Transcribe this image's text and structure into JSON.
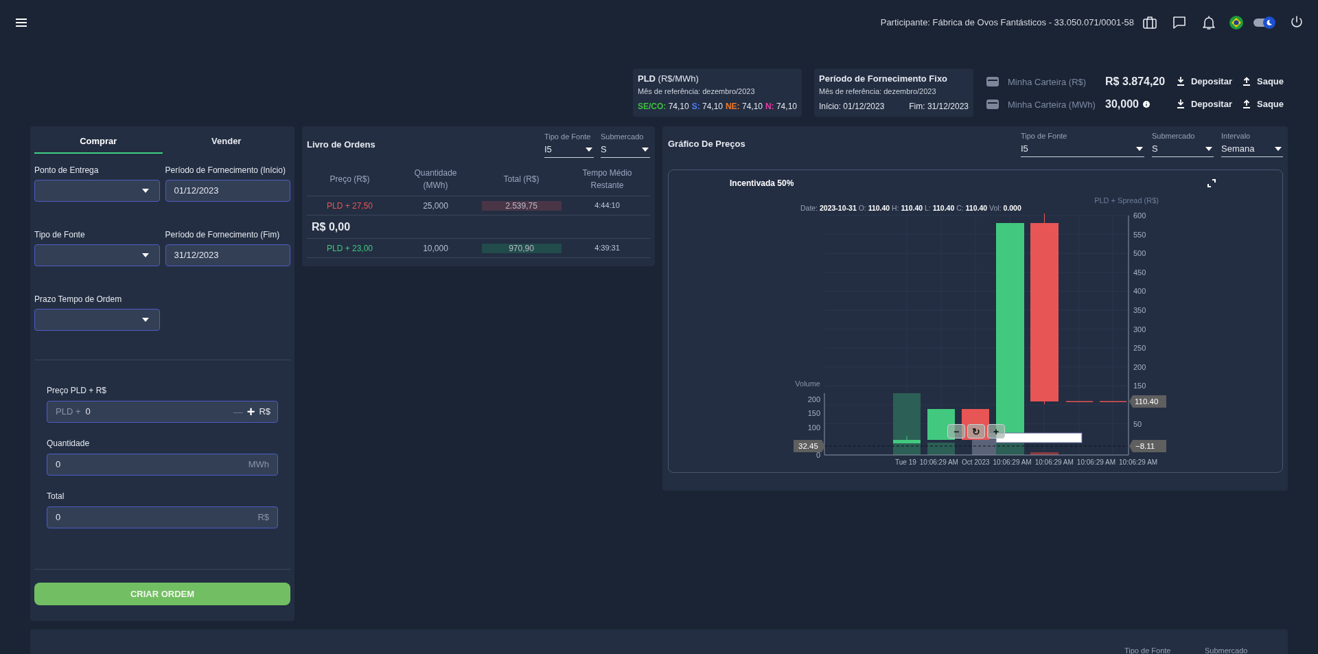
{
  "header": {
    "participant": "Participante: Fábrica de Ovos Fantásticos - 33.050.071/0001-58",
    "theme_toggle": {
      "on": true
    }
  },
  "pld_card": {
    "title": "PLD",
    "unit": "(R$/MWh)",
    "reference": "Mês de referência: dezembro/2023",
    "submarkets": [
      {
        "label": "SE/CO:",
        "value": "74,10",
        "color": "#3fbf3f"
      },
      {
        "label": "S:",
        "value": "74,10",
        "color": "#4f7dff"
      },
      {
        "label": "NE:",
        "value": "74,10",
        "color": "#f07a2a"
      },
      {
        "label": "N:",
        "value": "74,10",
        "color": "#e83aa8"
      }
    ]
  },
  "supply_card": {
    "title": "Período de Fornecimento Fixo",
    "reference": "Mês de referência: dezembro/2023",
    "start": "Início: 01/12/2023",
    "end": "Fim: 31/12/2023"
  },
  "wallets": [
    {
      "label": "Minha Carteira (R$)",
      "balance": "R$ 3.874,20",
      "info": false,
      "deposit": "Depositar",
      "withdraw": "Saque"
    },
    {
      "label": "Minha Carteira (MWh)",
      "balance": "30,000",
      "info": true,
      "deposit": "Depositar",
      "withdraw": "Saque"
    }
  ],
  "order_form": {
    "tabs": [
      {
        "label": "Comprar",
        "selected": true
      },
      {
        "label": "Vender",
        "selected": false
      }
    ],
    "fields": [
      {
        "label": "Ponto de Entrega",
        "kind": "select"
      },
      {
        "label": "Período de Fornecimento (Início)",
        "kind": "date",
        "value": "01/12/2023"
      },
      {
        "label": "Tipo de Fonte",
        "kind": "select"
      },
      {
        "label": "Período de Fornecimento (Fim)",
        "kind": "date",
        "value": "31/12/2023"
      },
      {
        "label": "Prazo Tempo de Ordem",
        "kind": "select"
      }
    ],
    "price": {
      "label": "Preço PLD + R$",
      "prefix": "PLD +",
      "value": "0",
      "decrement": "—",
      "increment": "+",
      "decrement_disabled": true,
      "suffix": "R$"
    },
    "quantity": {
      "label": "Quantidade",
      "value": "0",
      "suffix": "MWh"
    },
    "total": {
      "label": "Total",
      "value": "0",
      "suffix": "R$"
    },
    "submit": "CRIAR ORDEM"
  },
  "order_book": {
    "title": "Livro de Ordens",
    "filters": [
      {
        "label": "Tipo de Fonte",
        "value": "I5"
      },
      {
        "label": "Submercado",
        "value": "S"
      }
    ],
    "columns": [
      "Preço (R$)",
      "Quantidade (MWh)",
      "Total (R$)",
      "Tempo Médio Restante"
    ],
    "sell_orders": [
      {
        "price": "PLD + 27,50",
        "quantity": "25,000",
        "total": "2.539,75",
        "time": "4:44:10"
      }
    ],
    "last_price": "R$ 0,00",
    "buy_orders": [
      {
        "price": "PLD + 23,00",
        "quantity": "10,000",
        "total": "970,90",
        "time": "4:39:31"
      }
    ]
  },
  "price_chart": {
    "title": "Gráfico De Preços",
    "filters": [
      {
        "label": "Tipo de Fonte",
        "value": "I5"
      },
      {
        "label": "Submercado",
        "value": "S"
      },
      {
        "label": "Intervalo",
        "value": "Semana"
      }
    ],
    "series_name": "Incentivada 50%",
    "legend": [
      {
        "label": "Date:",
        "value": "2023-10-31"
      },
      {
        "label": "O:",
        "value": "110.40"
      },
      {
        "label": "H:",
        "value": "110.40"
      },
      {
        "label": "L:",
        "value": "110.40"
      },
      {
        "label": "C:",
        "value": "110.40"
      },
      {
        "label": "Vol:",
        "value": "0.000"
      }
    ],
    "y_axis_title": "PLD + Spread (R$)",
    "y_ticks": [
      "600",
      "550",
      "500",
      "450",
      "400",
      "350",
      "300",
      "250",
      "200",
      "150"
    ],
    "y_tick_low": "50",
    "last_price_marker": "110.40",
    "crosshair_price": "−8.11",
    "crosshair_volume": "32.45",
    "volume_title": "Volume",
    "volume_ticks": [
      "200",
      "150",
      "100"
    ],
    "volume_zero": "0",
    "x_labels": [
      "Tue 19",
      "10:06:29 AM",
      "Oct 2023",
      "10:06:29 AM",
      "10:06:29 AM",
      "10:06:29 AM",
      "10:06:29 AM"
    ],
    "zoom_controls": [
      "−",
      "↻",
      "+"
    ]
  },
  "bottom_panel": {
    "filter_labels": [
      "Tipo de Fonte",
      "Submercado"
    ]
  }
}
